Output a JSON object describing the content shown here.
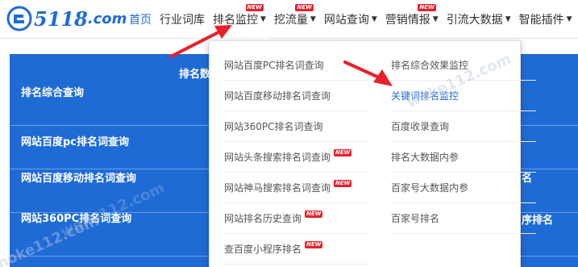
{
  "logo": {
    "text": "5118",
    "com": ".com"
  },
  "nav": [
    {
      "label": "首页",
      "active": true
    },
    {
      "label": "行业词库"
    },
    {
      "label": "排名监控",
      "caret": "▼",
      "badge": "NEW",
      "open": true
    },
    {
      "label": "挖流量",
      "caret": "▼",
      "badge": "NEW"
    },
    {
      "label": "网站查询",
      "caret": "▼"
    },
    {
      "label": "营销情报",
      "caret": "▼",
      "badge": "NEW"
    },
    {
      "label": "引流大数据",
      "caret": "▼"
    },
    {
      "label": "智能插件",
      "caret": "▼"
    }
  ],
  "panel": {
    "heading": "排名数",
    "rows": [
      "排名综合查询",
      "网站百度pc排名词查询",
      "网站百度移动排名词查询",
      "网站360PC排名词查询"
    ],
    "right_fragments": [
      "名",
      "序排名"
    ]
  },
  "dropdown": {
    "left": [
      {
        "label": "网站百度PC排名词查询"
      },
      {
        "label": "网站百度移动排名词查询"
      },
      {
        "label": "网站360PC排名词查询"
      },
      {
        "label": "网站头条搜索排名词查询",
        "badge": "NEW"
      },
      {
        "label": "网站神马搜索排名词查询",
        "badge": "NEW"
      },
      {
        "label": "网站排名历史查询",
        "badge": "NEW"
      },
      {
        "label": "查百度小程序排名",
        "badge": "NEW"
      }
    ],
    "right": [
      {
        "label": "排名综合效果监控"
      },
      {
        "label": "关键词排名监控",
        "highlight": true
      },
      {
        "label": "百度收录查询"
      },
      {
        "label": "排名大数据内参"
      },
      {
        "label": "百家号大数据内参"
      },
      {
        "label": "百家号排名"
      }
    ]
  },
  "watermarks": [
    "hoke112.com",
    "woke112.com",
    "woke112.com"
  ],
  "colors": {
    "brand": "#1e6bd6",
    "badge": "#e8202a",
    "arrow": "#e8202a"
  }
}
